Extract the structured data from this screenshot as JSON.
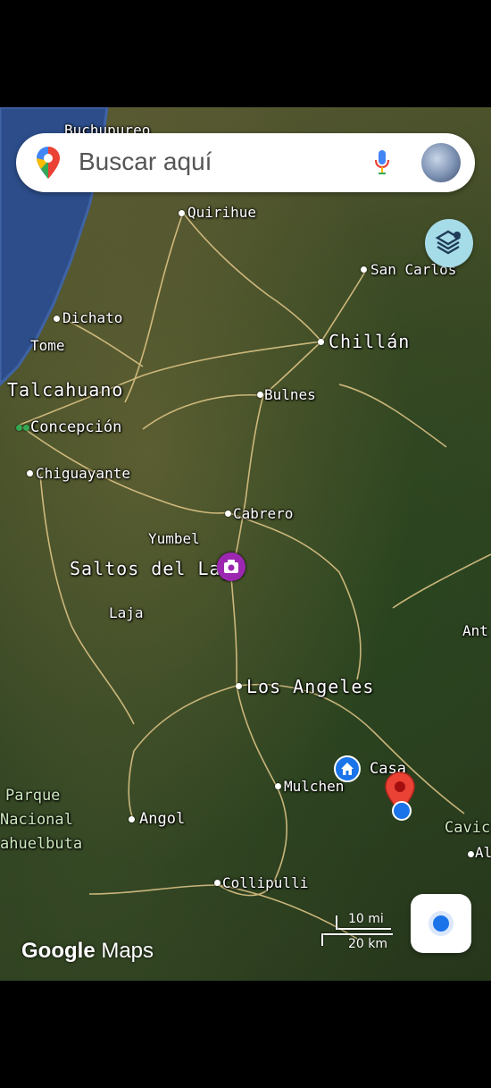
{
  "search": {
    "placeholder": "Buscar aquí"
  },
  "brand": {
    "google": "Google",
    "maps": "Maps"
  },
  "scale": {
    "miles": "10 mi",
    "km": "20 km"
  },
  "icons": [
    "google-maps-pin-icon",
    "microphone-icon",
    "layers-icon",
    "camera-icon",
    "home-icon",
    "location-pin-icon",
    "my-location-icon"
  ],
  "colors": {
    "pin_red": "#ea4335",
    "blue": "#1a73e8",
    "camera_purple": "#9c27b0"
  },
  "places": {
    "buchupureo": "Buchupureo",
    "quirihue": "Quirihue",
    "san_carlos": "San Carlos",
    "dichato": "Dichato",
    "tome": "Tome",
    "chillan": "Chillán",
    "talcahuano": "Talcahuano",
    "bulnes": "Bulnes",
    "concepcion": "Concepción",
    "chiguayante": "Chiguayante",
    "cabrero": "Cabrero",
    "yumbel": "Yumbel",
    "saltos_del_laja": "Saltos del Laja",
    "laja": "Laja",
    "ant": "Ant",
    "los_angeles": "Los Angeles",
    "casa": "Casa",
    "mulchen": "Mulchen",
    "parque_line1": "Parque",
    "parque_line2": "Nacional",
    "parque_line3": "ahuelbuta",
    "angol": "Angol",
    "cavic": "Cavic",
    "al": "Al",
    "collipulli": "Collipulli"
  }
}
